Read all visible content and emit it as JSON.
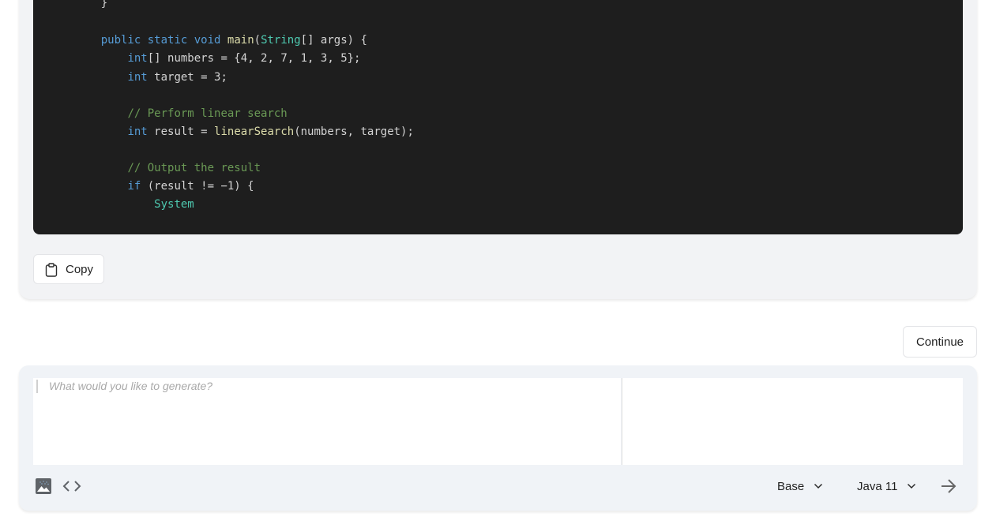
{
  "code_block": {
    "language": "Java",
    "lines": [
      [
        {
          "t": "    }",
          "c": "pl"
        }
      ],
      [],
      [
        {
          "t": "    ",
          "c": "pl"
        },
        {
          "t": "public",
          "c": "kw"
        },
        {
          "t": " ",
          "c": "pl"
        },
        {
          "t": "static",
          "c": "kw"
        },
        {
          "t": " ",
          "c": "pl"
        },
        {
          "t": "void",
          "c": "kw"
        },
        {
          "t": " ",
          "c": "pl"
        },
        {
          "t": "main",
          "c": "fn"
        },
        {
          "t": "(",
          "c": "pl"
        },
        {
          "t": "String",
          "c": "type"
        },
        {
          "t": "[] args) {",
          "c": "pl"
        }
      ],
      [
        {
          "t": "        ",
          "c": "pl"
        },
        {
          "t": "int",
          "c": "kw"
        },
        {
          "t": "[] numbers = {",
          "c": "pl"
        },
        {
          "t": "4",
          "c": "pl"
        },
        {
          "t": ", 2, 7, 1, 3, 5};",
          "c": "pl"
        }
      ],
      [
        {
          "t": "        ",
          "c": "pl"
        },
        {
          "t": "int",
          "c": "kw"
        },
        {
          "t": " target = 3;",
          "c": "pl"
        }
      ],
      [],
      [
        {
          "t": "        ",
          "c": "pl"
        },
        {
          "t": "// Perform linear search",
          "c": "cm"
        }
      ],
      [
        {
          "t": "        ",
          "c": "pl"
        },
        {
          "t": "int",
          "c": "kw"
        },
        {
          "t": " result = ",
          "c": "pl"
        },
        {
          "t": "linearSearch",
          "c": "fn"
        },
        {
          "t": "(numbers, target);",
          "c": "pl"
        }
      ],
      [],
      [
        {
          "t": "        ",
          "c": "pl"
        },
        {
          "t": "// Output the result",
          "c": "cm"
        }
      ],
      [
        {
          "t": "        ",
          "c": "pl"
        },
        {
          "t": "if",
          "c": "kw"
        },
        {
          "t": " (result != −1) {",
          "c": "pl"
        }
      ],
      [
        {
          "t": "            ",
          "c": "pl"
        },
        {
          "t": "System",
          "c": "type"
        }
      ]
    ],
    "line_tops": [
      2,
      0,
      49,
      72,
      96,
      0,
      142,
      165,
      0,
      211,
      234,
      257
    ]
  },
  "actions": {
    "copy_label": "Copy",
    "copy_icon": "clipboard-icon",
    "continue_label": "Continue"
  },
  "prompt": {
    "placeholder": "What would you like to generate?",
    "value": "",
    "toolbar": {
      "image_icon": "image-icon",
      "code_icon": "code-icon",
      "mode": {
        "selected": "Base"
      },
      "language": {
        "selected": "Java 11"
      },
      "send_icon": "arrow-right-icon"
    }
  },
  "colors": {
    "code_background": "#1e1e1e",
    "keyword": "#569cd6",
    "type": "#4ec9b0",
    "function": "#dcdcaa",
    "comment": "#6a9955",
    "panel_background": "#f0f3f7"
  }
}
